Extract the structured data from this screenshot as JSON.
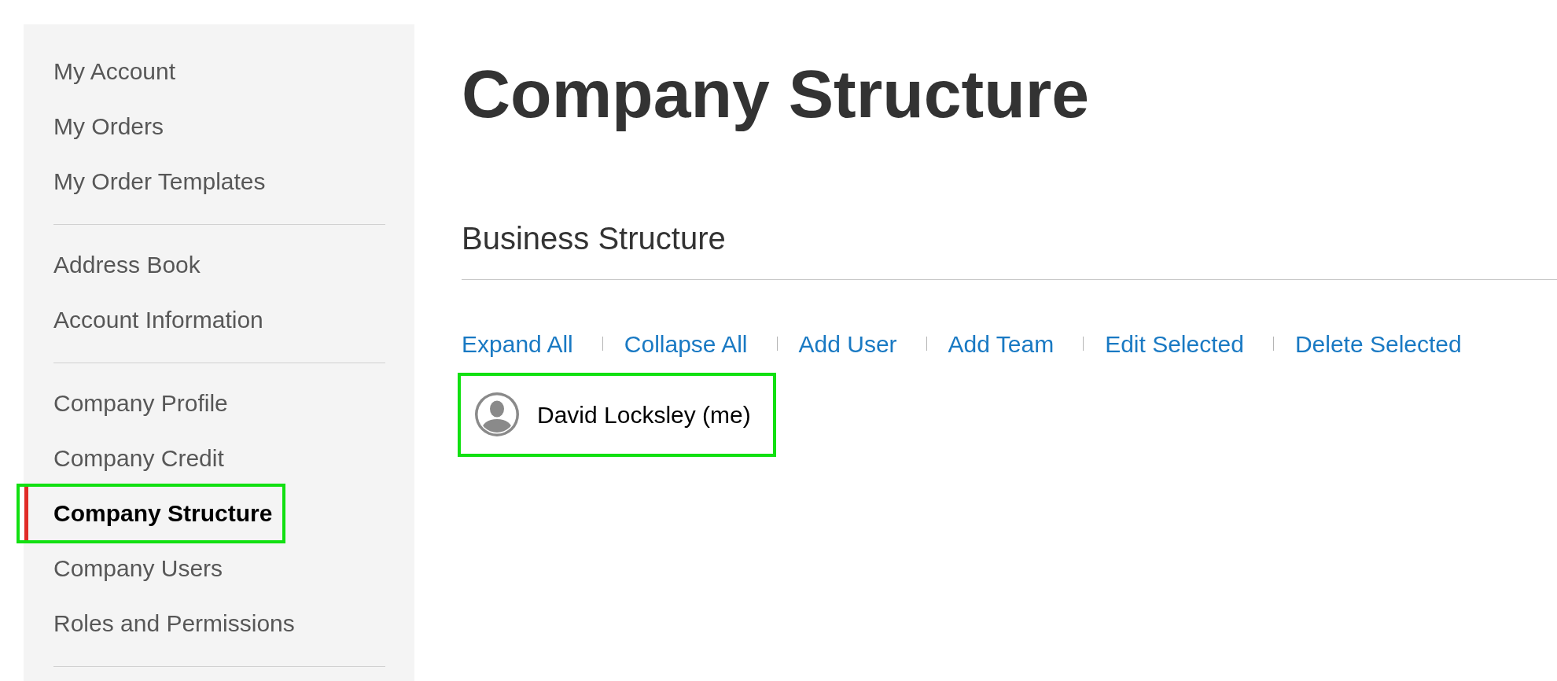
{
  "sidebar": {
    "groups": [
      {
        "items": [
          {
            "label": "My Account",
            "selected": false,
            "highlighted": false
          },
          {
            "label": "My Orders",
            "selected": false,
            "highlighted": false
          },
          {
            "label": "My Order Templates",
            "selected": false,
            "highlighted": false
          }
        ]
      },
      {
        "items": [
          {
            "label": "Address Book",
            "selected": false,
            "highlighted": false
          },
          {
            "label": "Account Information",
            "selected": false,
            "highlighted": false
          }
        ]
      },
      {
        "items": [
          {
            "label": "Company Profile",
            "selected": false,
            "highlighted": false
          },
          {
            "label": "Company Credit",
            "selected": false,
            "highlighted": false
          },
          {
            "label": "Company Structure",
            "selected": true,
            "highlighted": true
          },
          {
            "label": "Company Users",
            "selected": false,
            "highlighted": false
          },
          {
            "label": "Roles and Permissions",
            "selected": false,
            "highlighted": false
          }
        ]
      }
    ]
  },
  "page_title": "Company Structure",
  "section": {
    "title": "Business Structure",
    "actions": [
      "Expand All",
      "Collapse All",
      "Add User",
      "Add Team",
      "Edit Selected",
      "Delete Selected"
    ],
    "tree": [
      {
        "label": "David Locksley (me)",
        "highlighted": true
      }
    ]
  }
}
